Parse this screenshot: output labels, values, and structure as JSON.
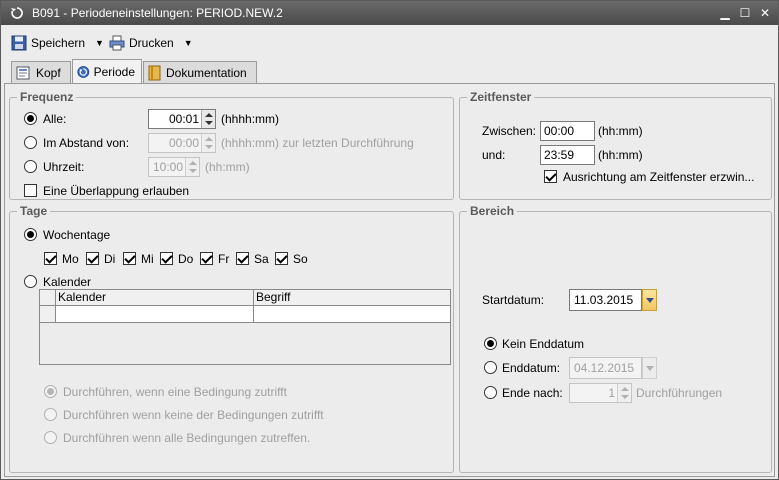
{
  "window": {
    "title": "B091 - Periodeneinstellungen: PERIOD.NEW.2",
    "minimize": "▁",
    "maximize": "☐",
    "close": "✕"
  },
  "toolbar": {
    "save_label": "Speichern",
    "print_label": "Drucken"
  },
  "tabs": [
    {
      "label": "Kopf",
      "icon": "header-icon",
      "active": false
    },
    {
      "label": "Periode",
      "icon": "period-icon",
      "active": true
    },
    {
      "label": "Dokumentation",
      "icon": "book-icon",
      "active": false
    }
  ],
  "frequenz": {
    "title": "Frequenz",
    "alle_label": "Alle:",
    "alle_value": "00:01",
    "alle_unit": "(hhhh:mm)",
    "abstand_label": "Im Abstand von:",
    "abstand_value": "00:00",
    "abstand_unit": "(hhhh:mm) zur letzten Durchführung",
    "uhrzeit_label": "Uhrzeit:",
    "uhrzeit_value": "10:00",
    "uhrzeit_unit": "(hh:mm)",
    "overlap_label": "Eine Überlappung erlauben"
  },
  "zeitfenster": {
    "title": "Zeitfenster",
    "zwischen_label": "Zwischen:",
    "zwischen_value": "00:00",
    "zwischen_unit": "(hh:mm)",
    "und_label": "und:",
    "und_value": "23:59",
    "und_unit": "(hh:mm)",
    "align_label": "Ausrichtung am Zeitfenster erzwin..."
  },
  "tage": {
    "title": "Tage",
    "wochentage_label": "Wochentage",
    "days": [
      "Mo",
      "Di",
      "Mi",
      "Do",
      "Fr",
      "Sa",
      "So"
    ],
    "kalender_label": "Kalender",
    "grid_columns": [
      "Kalender",
      "Begriff"
    ],
    "cond_any": "Durchführen, wenn eine Bedingung zutrifft",
    "cond_none": "Durchführen wenn keine der Bedingungen zutrifft",
    "cond_all": "Durchführen wenn alle Bedingungen zutreffen."
  },
  "bereich": {
    "title": "Bereich",
    "start_label": "Startdatum:",
    "start_value": "11.03.2015",
    "kein_label": "Kein Enddatum",
    "end_label": "Enddatum:",
    "end_value": "04.12.2015",
    "nach_label": "Ende nach:",
    "nach_value": "1",
    "nach_unit": "Durchführungen"
  }
}
